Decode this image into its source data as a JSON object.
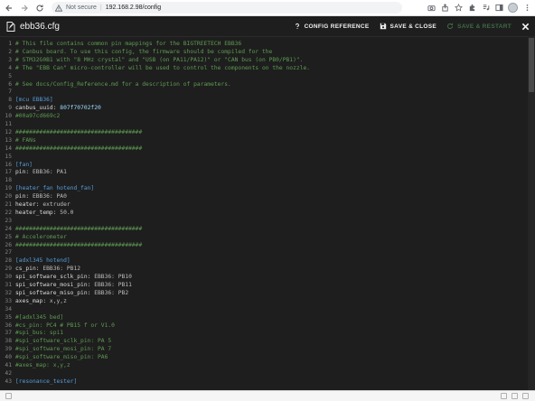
{
  "browser": {
    "security_label": "Not secure",
    "url": "192.168.2.98/config"
  },
  "dialog": {
    "filename": "ebb36.cfg",
    "config_reference_label": "CONFIG REFERENCE",
    "save_close_label": "SAVE & CLOSE",
    "save_restart_label": "SAVE & RESTART"
  },
  "colors": {
    "comment": "#5e9a52",
    "section": "#569cd6",
    "accent_disabled": "#3f6b44",
    "background": "#1e1e1e"
  },
  "lines": [
    {
      "n": "1",
      "type": "comment",
      "text": "# This file contains common pin mappings for the BIGTREETECH EBB36"
    },
    {
      "n": "2",
      "type": "comment",
      "text": "# Canbus board. To use this config, the firmware should be compiled for the"
    },
    {
      "n": "3",
      "type": "comment",
      "text": "# STM32G0B1 with \"8 MHz crystal\" and \"USB (on PA11/PA12)\" or \"CAN bus (on PB0/PB1)\"."
    },
    {
      "n": "4",
      "type": "comment",
      "text": "# The \"EBB Can\" micro-controller will be used to control the components on the nozzle."
    },
    {
      "n": "5",
      "type": "blank",
      "text": ""
    },
    {
      "n": "6",
      "type": "comment",
      "text": "# See docs/Config_Reference.md for a description of parameters."
    },
    {
      "n": "7",
      "type": "blank",
      "text": ""
    },
    {
      "n": "8",
      "type": "section",
      "text": "[mcu EBB36]"
    },
    {
      "n": "9",
      "type": "kv",
      "key": "canbus_uuid:",
      "value": "807f70702f20"
    },
    {
      "n": "10",
      "type": "comment",
      "text": "#00a97cd669c2"
    },
    {
      "n": "11",
      "type": "blank",
      "text": ""
    },
    {
      "n": "12",
      "type": "comment",
      "text": "#####################################"
    },
    {
      "n": "13",
      "type": "comment",
      "text": "# FANs"
    },
    {
      "n": "14",
      "type": "comment",
      "text": "#####################################"
    },
    {
      "n": "15",
      "type": "blank",
      "text": ""
    },
    {
      "n": "16",
      "type": "section",
      "text": "[fan]"
    },
    {
      "n": "17",
      "type": "kv",
      "key": "pin:",
      "value": "EBB36: PA1"
    },
    {
      "n": "18",
      "type": "blank",
      "text": ""
    },
    {
      "n": "19",
      "type": "section",
      "text": "[heater_fan hotend_fan]"
    },
    {
      "n": "20",
      "type": "kv",
      "key": "pin:",
      "value": "EBB36: PA0"
    },
    {
      "n": "21",
      "type": "kv",
      "key": "heater:",
      "value": "extruder"
    },
    {
      "n": "22",
      "type": "kv",
      "key": "heater_temp:",
      "value": "50.0"
    },
    {
      "n": "23",
      "type": "blank",
      "text": ""
    },
    {
      "n": "24",
      "type": "comment",
      "text": "#####################################"
    },
    {
      "n": "25",
      "type": "comment",
      "text": "# Accelerometer"
    },
    {
      "n": "26",
      "type": "comment",
      "text": "#####################################"
    },
    {
      "n": "27",
      "type": "blank",
      "text": ""
    },
    {
      "n": "28",
      "type": "section",
      "text": "[adxl345 hotend]"
    },
    {
      "n": "29",
      "type": "kv",
      "key": "cs_pin:",
      "value": "EBB36: PB12"
    },
    {
      "n": "30",
      "type": "kv",
      "key": "spi_software_sclk_pin:",
      "value": "EBB36: PB10"
    },
    {
      "n": "31",
      "type": "kv",
      "key": "spi_software_mosi_pin:",
      "value": "EBB36: PB11"
    },
    {
      "n": "32",
      "type": "kv",
      "key": "spi_software_miso_pin:",
      "value": "EBB36: PB2"
    },
    {
      "n": "33",
      "type": "kv",
      "key": "axes_map:",
      "value": "x,y,z"
    },
    {
      "n": "34",
      "type": "blank",
      "text": ""
    },
    {
      "n": "35",
      "type": "comment",
      "text": "#[adxl345 bed]"
    },
    {
      "n": "36",
      "type": "comment",
      "text": "#cs_pin: PC4 # PB15 f or V1.0"
    },
    {
      "n": "37",
      "type": "comment",
      "text": "#spi_bus: spi1"
    },
    {
      "n": "38",
      "type": "comment",
      "text": "#spi_software_sclk_pin: PA 5"
    },
    {
      "n": "39",
      "type": "comment",
      "text": "#spi_software_mosi_pin: PA 7"
    },
    {
      "n": "40",
      "type": "comment",
      "text": "#spi_software_miso_pin: PA6"
    },
    {
      "n": "41",
      "type": "comment",
      "text": "#axes_map: x,y,z"
    },
    {
      "n": "42",
      "type": "blank",
      "text": ""
    },
    {
      "n": "43",
      "type": "section",
      "text": "[resonance_tester]"
    }
  ]
}
